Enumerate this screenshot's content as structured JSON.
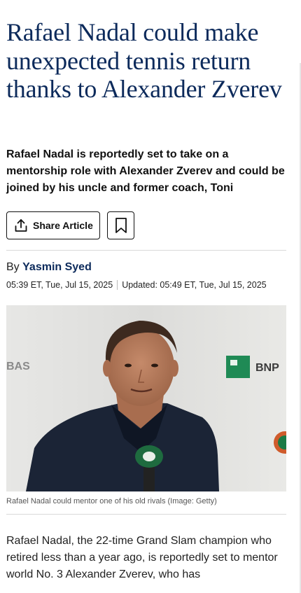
{
  "article": {
    "headline": "Rafael Nadal could make unexpected tennis return thanks to Alexander Zverev",
    "standfirst": "Rafael Nadal is reportedly set to take on a mentorship role with Alexander Zverev and could be joined by his uncle and former coach, Toni",
    "share_label": "Share Article",
    "byline_prefix": "By",
    "author": "Yasmin Syed",
    "published": "05:39 ET, Tue, Jul 15, 2025",
    "updated": "Updated: 05:49 ET, Tue, Jul 15, 2025",
    "image_alt": "Rafael Nadal speaking at a press conference",
    "image_backdrop_left": "BAS",
    "image_backdrop_right": "BNP",
    "caption": "Rafael Nadal could mentor one of his old rivals (Image: Getty)",
    "body": "Rafael Nadal, the 22-time Grand Slam champion who retired less than a year ago, is reportedly set to mentor world No. 3 Alexander Zverev, who has"
  },
  "icons": {
    "share": "share-icon",
    "bookmark": "bookmark-icon"
  },
  "colors": {
    "headline": "#0c2a5b",
    "author": "#0c2a5b",
    "rule": "#d9d9d9"
  }
}
